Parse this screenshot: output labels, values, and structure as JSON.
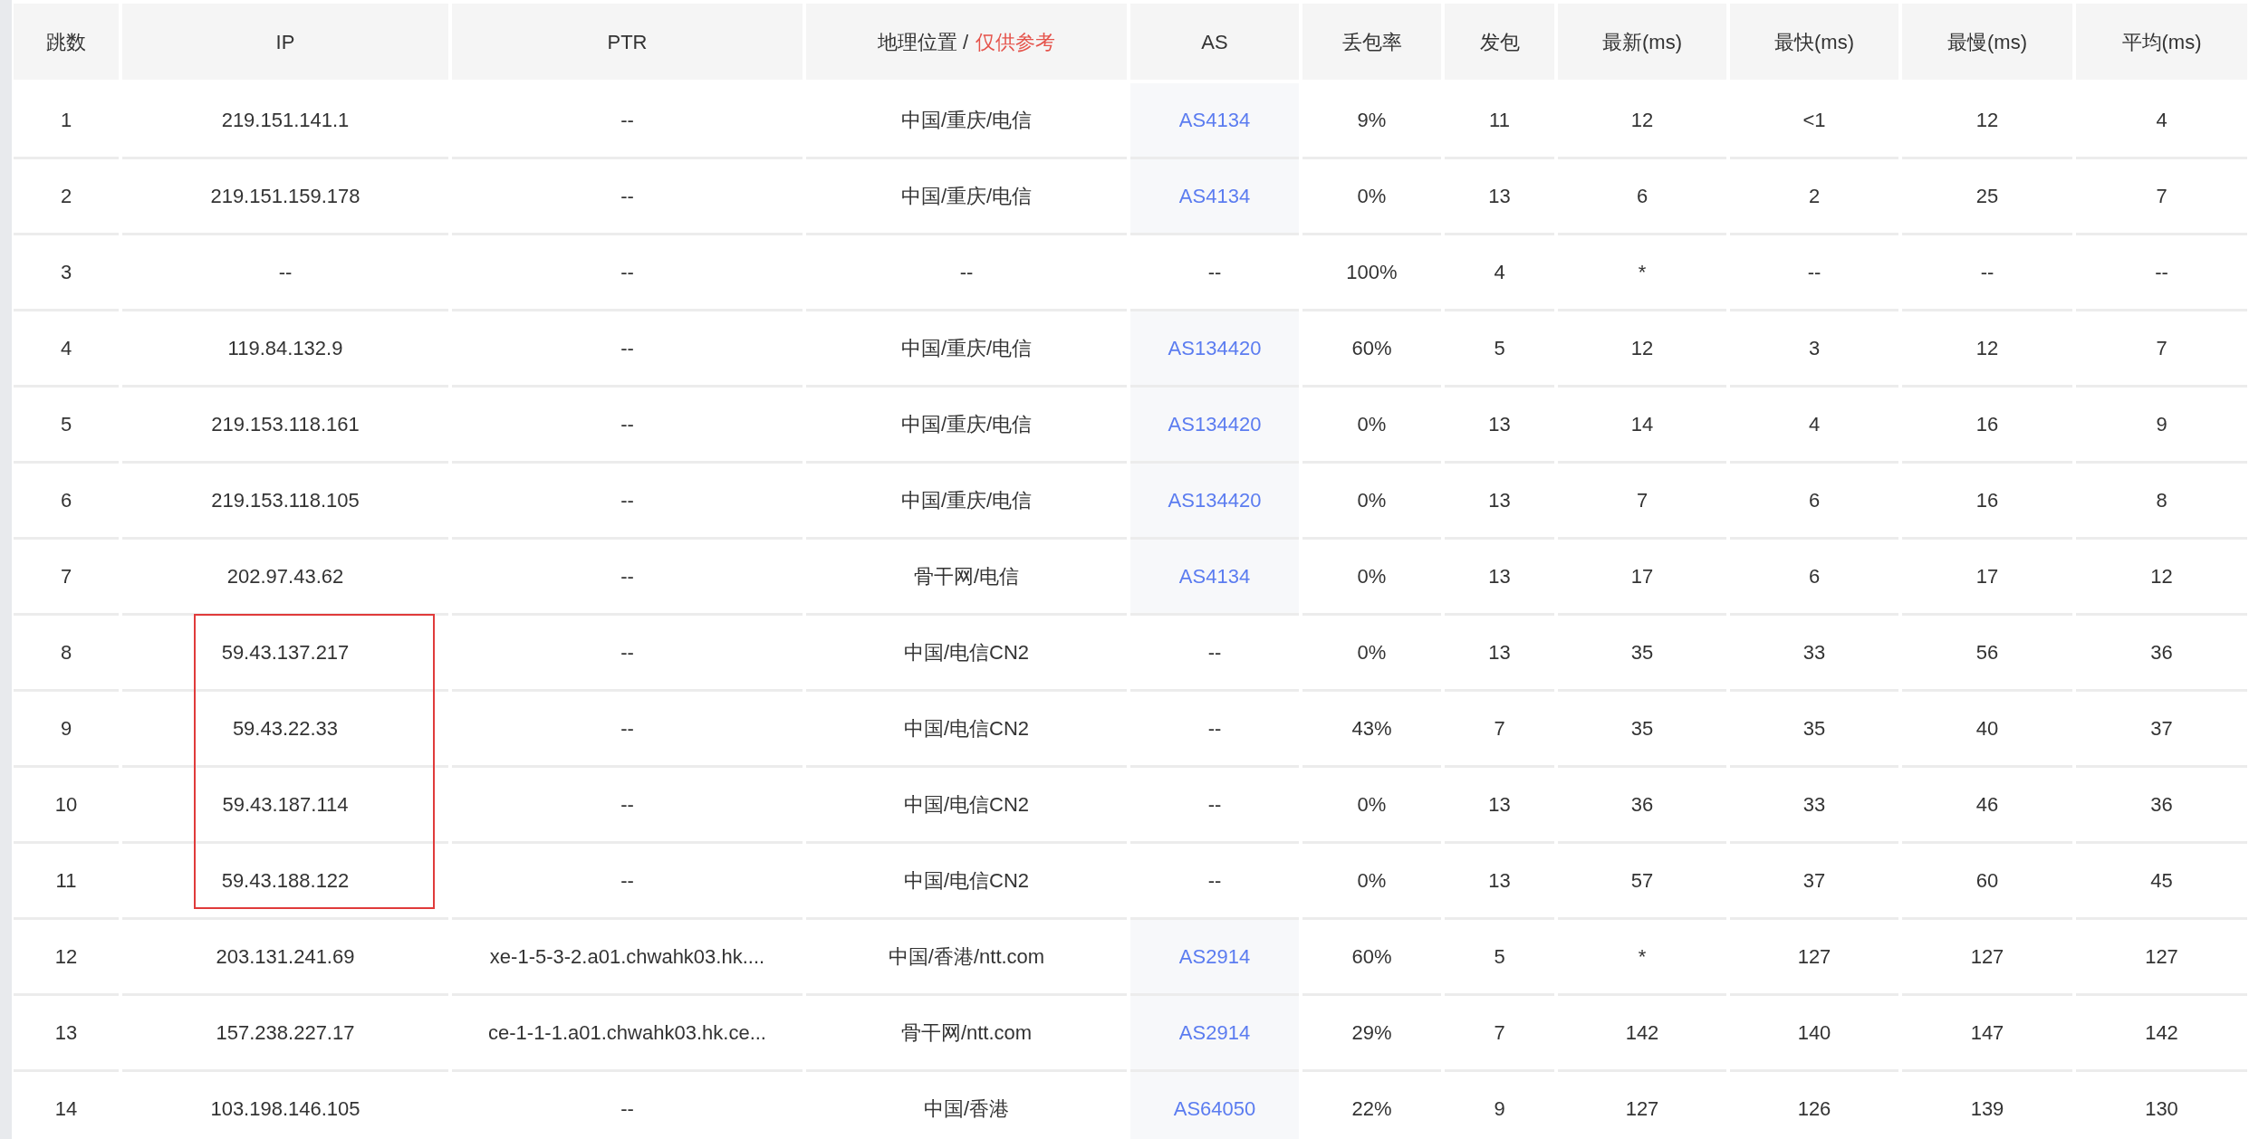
{
  "columns": [
    {
      "label": "跳数"
    },
    {
      "label": "IP"
    },
    {
      "label": "PTR"
    },
    {
      "label": "地理位置 /",
      "note": "仅供参考"
    },
    {
      "label": "AS"
    },
    {
      "label": "丢包率"
    },
    {
      "label": "发包"
    },
    {
      "label": "最新(ms)"
    },
    {
      "label": "最快(ms)"
    },
    {
      "label": "最慢(ms)"
    },
    {
      "label": "平均(ms)"
    }
  ],
  "rows": [
    {
      "hop": "1",
      "ip": "219.151.141.1",
      "ptr": "--",
      "geo": "中国/重庆/电信",
      "as": "AS4134",
      "as_link": true,
      "loss": "9%",
      "sent": "11",
      "last": "12",
      "best": "<1",
      "worst": "12",
      "avg": "4",
      "highlighted": false
    },
    {
      "hop": "2",
      "ip": "219.151.159.178",
      "ptr": "--",
      "geo": "中国/重庆/电信",
      "as": "AS4134",
      "as_link": true,
      "loss": "0%",
      "sent": "13",
      "last": "6",
      "best": "2",
      "worst": "25",
      "avg": "7",
      "highlighted": false
    },
    {
      "hop": "3",
      "ip": "--",
      "ptr": "--",
      "geo": "--",
      "as": "--",
      "as_link": false,
      "loss": "100%",
      "sent": "4",
      "last": "*",
      "best": "--",
      "worst": "--",
      "avg": "--",
      "highlighted": false
    },
    {
      "hop": "4",
      "ip": "119.84.132.9",
      "ptr": "--",
      "geo": "中国/重庆/电信",
      "as": "AS134420",
      "as_link": true,
      "loss": "60%",
      "sent": "5",
      "last": "12",
      "best": "3",
      "worst": "12",
      "avg": "7",
      "highlighted": false
    },
    {
      "hop": "5",
      "ip": "219.153.118.161",
      "ptr": "--",
      "geo": "中国/重庆/电信",
      "as": "AS134420",
      "as_link": true,
      "loss": "0%",
      "sent": "13",
      "last": "14",
      "best": "4",
      "worst": "16",
      "avg": "9",
      "highlighted": false
    },
    {
      "hop": "6",
      "ip": "219.153.118.105",
      "ptr": "--",
      "geo": "中国/重庆/电信",
      "as": "AS134420",
      "as_link": true,
      "loss": "0%",
      "sent": "13",
      "last": "7",
      "best": "6",
      "worst": "16",
      "avg": "8",
      "highlighted": false
    },
    {
      "hop": "7",
      "ip": "202.97.43.62",
      "ptr": "--",
      "geo": "骨干网/电信",
      "as": "AS4134",
      "as_link": true,
      "loss": "0%",
      "sent": "13",
      "last": "17",
      "best": "6",
      "worst": "17",
      "avg": "12",
      "highlighted": false
    },
    {
      "hop": "8",
      "ip": "59.43.137.217",
      "ptr": "--",
      "geo": "中国/电信CN2",
      "as": "--",
      "as_link": false,
      "loss": "0%",
      "sent": "13",
      "last": "35",
      "best": "33",
      "worst": "56",
      "avg": "36",
      "highlighted": true
    },
    {
      "hop": "9",
      "ip": "59.43.22.33",
      "ptr": "--",
      "geo": "中国/电信CN2",
      "as": "--",
      "as_link": false,
      "loss": "43%",
      "sent": "7",
      "last": "35",
      "best": "35",
      "worst": "40",
      "avg": "37",
      "highlighted": true
    },
    {
      "hop": "10",
      "ip": "59.43.187.114",
      "ptr": "--",
      "geo": "中国/电信CN2",
      "as": "--",
      "as_link": false,
      "loss": "0%",
      "sent": "13",
      "last": "36",
      "best": "33",
      "worst": "46",
      "avg": "36",
      "highlighted": true
    },
    {
      "hop": "11",
      "ip": "59.43.188.122",
      "ptr": "--",
      "geo": "中国/电信CN2",
      "as": "--",
      "as_link": false,
      "loss": "0%",
      "sent": "13",
      "last": "57",
      "best": "37",
      "worst": "60",
      "avg": "45",
      "highlighted": true
    },
    {
      "hop": "12",
      "ip": "203.131.241.69",
      "ptr": "xe-1-5-3-2.a01.chwahk03.hk....",
      "geo": "中国/香港/ntt.com",
      "as": "AS2914",
      "as_link": true,
      "loss": "60%",
      "sent": "5",
      "last": "*",
      "best": "127",
      "worst": "127",
      "avg": "127",
      "highlighted": false
    },
    {
      "hop": "13",
      "ip": "157.238.227.17",
      "ptr": "ce-1-1-1.a01.chwahk03.hk.ce...",
      "geo": "骨干网/ntt.com",
      "as": "AS2914",
      "as_link": true,
      "loss": "29%",
      "sent": "7",
      "last": "142",
      "best": "140",
      "worst": "147",
      "avg": "142",
      "highlighted": false
    },
    {
      "hop": "14",
      "ip": "103.198.146.105",
      "ptr": "--",
      "geo": "中国/香港",
      "as": "AS64050",
      "as_link": true,
      "loss": "22%",
      "sent": "9",
      "last": "127",
      "best": "126",
      "worst": "139",
      "avg": "130",
      "highlighted": false
    }
  ]
}
